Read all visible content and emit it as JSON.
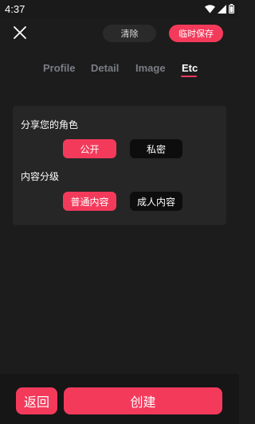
{
  "status_bar": {
    "time": "4:37",
    "icons": [
      "wifi-icon",
      "signal-icon",
      "battery-icon"
    ]
  },
  "topbar": {
    "close_icon": "close-icon",
    "clear_label": "清除",
    "save_label": "临时保存"
  },
  "tabs": [
    {
      "label": "Profile",
      "active": false
    },
    {
      "label": "Detail",
      "active": false
    },
    {
      "label": "Image",
      "active": false
    },
    {
      "label": "Etc",
      "active": true
    }
  ],
  "share": {
    "title": "分享您的角色",
    "options": [
      {
        "label": "公开",
        "selected": true
      },
      {
        "label": "私密",
        "selected": false
      }
    ]
  },
  "rating": {
    "title": "内容分级",
    "options": [
      {
        "label": "普通内容",
        "selected": true
      },
      {
        "label": "成人内容",
        "selected": false
      }
    ]
  },
  "footer": {
    "back_label": "返回",
    "create_label": "创建"
  },
  "colors": {
    "accent": "#f43a5b",
    "background": "#1c1c1c",
    "card": "#262626"
  }
}
